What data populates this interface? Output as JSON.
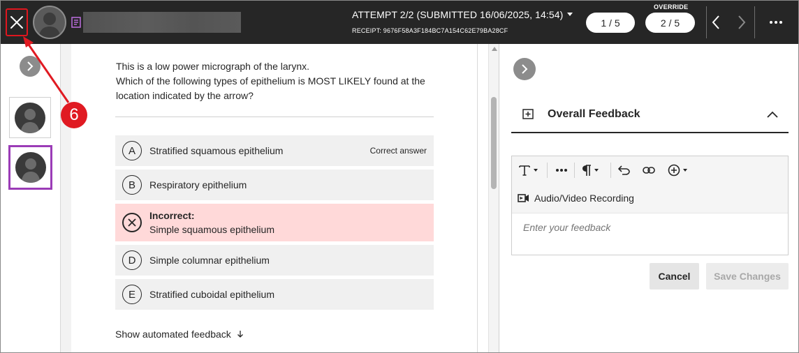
{
  "topbar": {
    "attempt_label": "ATTEMPT 2/2 (SUBMITTED 16/06/2025, 14:54)",
    "receipt_label": "RECEIPT: 9676F58A3F184BC7A154C62E79BA28CF",
    "override_label": "OVERRIDE",
    "pill_1": "1 / 5",
    "pill_2": "2 / 5",
    "icons": [
      "close-icon",
      "avatar",
      "document-icon",
      "chevron-down-icon",
      "chevron-left-icon",
      "chevron-right-icon",
      "more-icon"
    ]
  },
  "question": {
    "line_1": "This is a low power micrograph of the larynx.",
    "line_2": "Which of the following types of epithelium is MOST LIKELY found at the location indicated by the arrow?"
  },
  "options": [
    {
      "letter": "A",
      "text": "Stratified squamous epithelium",
      "tag": "Correct answer"
    },
    {
      "letter": "B",
      "text": "Respiratory epithelium"
    },
    {
      "status": "Incorrect:",
      "text": "Simple squamous epithelium"
    },
    {
      "letter": "D",
      "text": "Simple columnar epithelium"
    },
    {
      "letter": "E",
      "text": "Stratified cuboidal epithelium"
    }
  ],
  "show_feedback_label": "Show automated feedback",
  "feedback": {
    "title": "Overall Feedback",
    "av_recording_label": "Audio/Video Recording",
    "placeholder": "Enter your feedback",
    "cancel_label": "Cancel",
    "save_label": "Save Changes"
  },
  "annotation": {
    "number": "6"
  },
  "colors": {
    "topbar_bg": "#262626",
    "annotation_red": "#e01a22",
    "selected_border": "#9b3cb7",
    "incorrect_bg": "#ffd9d9"
  }
}
